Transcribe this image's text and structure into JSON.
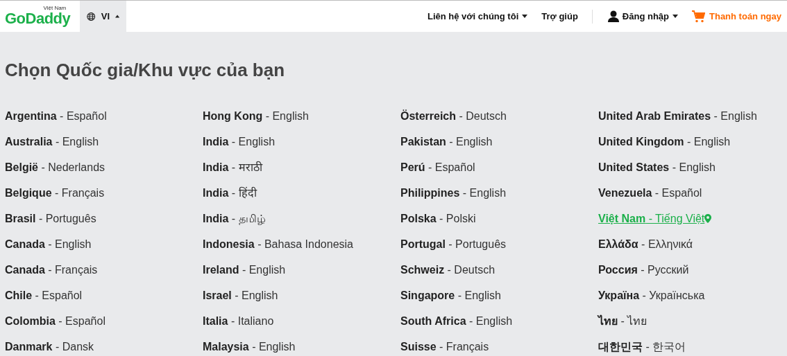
{
  "header": {
    "logo": "GoDaddy",
    "logo_region": "Việt Nam",
    "language_button": "VI",
    "nav": [
      {
        "label": "Liên hệ với chúng tôi",
        "kind": "dropdown"
      },
      {
        "label": "Trợ giúp",
        "kind": "link"
      }
    ],
    "sign_in": "Đăng nhập",
    "checkout": "Thanh toán ngay"
  },
  "title": "Chọn Quốc gia/Khu vực của bạn",
  "columns": [
    [
      {
        "text": "**Argentina** - Español",
        "selected": false
      },
      {
        "text": "**Australia** - English",
        "selected": false
      },
      {
        "text": "**België** - Nederlands",
        "selected": false
      },
      {
        "text": "**Belgique** - Français",
        "selected": false
      },
      {
        "text": "**Brasil** - Português",
        "selected": false
      },
      {
        "text": "**Canada** - English",
        "selected": false
      },
      {
        "text": "**Canada** - Français",
        "selected": false
      },
      {
        "text": "**Chile** - Español",
        "selected": false
      },
      {
        "text": "**Colombia** - Español",
        "selected": false
      },
      {
        "text": "**Danmark** - Dansk",
        "selected": false
      }
    ],
    [
      {
        "text": "**Hong Kong** - English",
        "selected": false
      },
      {
        "text": "**India** - English",
        "selected": false
      },
      {
        "text": "**India** - मराठी",
        "selected": false
      },
      {
        "text": "**India** - हिंदी",
        "selected": false
      },
      {
        "text": "**India** - தமிழ்",
        "selected": false
      },
      {
        "text": "**Indonesia** - Bahasa Indonesia",
        "selected": false
      },
      {
        "text": "**Ireland** - English",
        "selected": false
      },
      {
        "text": "**Israel** - English",
        "selected": false
      },
      {
        "text": "**Italia** - Italiano",
        "selected": false
      },
      {
        "text": "**Malaysia** - English",
        "selected": false
      }
    ],
    [
      {
        "text": "**Österreich** - Deutsch",
        "selected": false
      },
      {
        "text": "**Pakistan** - English",
        "selected": false
      },
      {
        "text": "**Perú** - Español",
        "selected": false
      },
      {
        "text": "**Philippines** - English",
        "selected": false
      },
      {
        "text": "**Polska** - Polski",
        "selected": false
      },
      {
        "text": "**Portugal** - Português",
        "selected": false
      },
      {
        "text": "**Schweiz** - Deutsch",
        "selected": false
      },
      {
        "text": "**Singapore** - English",
        "selected": false
      },
      {
        "text": "**South Africa** - English",
        "selected": false
      },
      {
        "text": "**Suisse** - Français",
        "selected": false
      }
    ],
    [
      {
        "text": "**United Arab Emirates** - English",
        "selected": false
      },
      {
        "text": "**United Kingdom** - English",
        "selected": false
      },
      {
        "text": "**United States** - English",
        "selected": false
      },
      {
        "text": "**Venezuela** - Español",
        "selected": false
      },
      {
        "text": "**Việt Nam** - Tiếng Việt",
        "selected": true
      },
      {
        "text": "**Ελλάδα** - Ελληνικά",
        "selected": false
      },
      {
        "text": "**Россия** - Русский",
        "selected": false
      },
      {
        "text": "**Україна** - Українська",
        "selected": false
      },
      {
        "text": "**ไทย** - ไทย",
        "selected": false
      },
      {
        "text": "**대한민국** - 한국어",
        "selected": false
      }
    ]
  ]
}
